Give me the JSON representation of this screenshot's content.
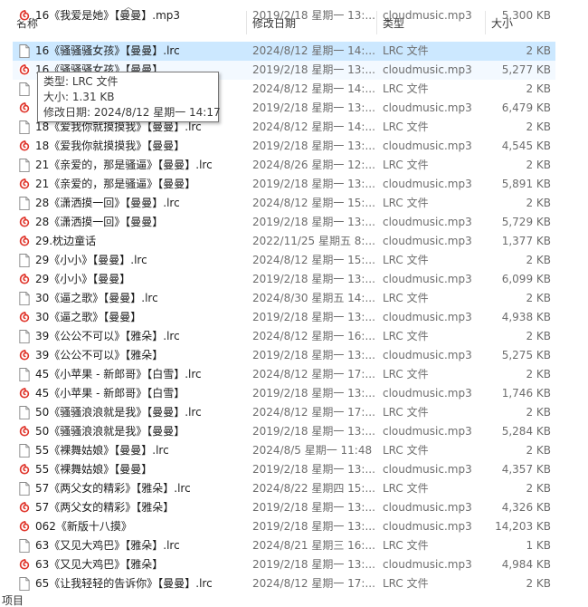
{
  "columns": {
    "name": "名称",
    "date": "修改日期",
    "type": "类型",
    "size": "大小"
  },
  "tooltip": {
    "type_line": "类型: LRC 文件",
    "size_line": "大小: 1.31 KB",
    "date_line": "修改日期: 2024/8/12 星期一 14:17"
  },
  "files": [
    {
      "name": "16《我爱是她》【曼曼】.mp3",
      "date": "2019/2/18 星期一 13:...",
      "type": "cloudmusic.mp3",
      "size": "5,300 KB",
      "kind": "mp3"
    },
    {
      "name": "16《骚骚骚女孩》【曼曼】.lrc",
      "date": "2024/8/12 星期一 14:...",
      "type": "LRC 文件",
      "size": "2 KB",
      "kind": "lrc"
    },
    {
      "name": "16《骚骚骚女孩》【曼曼】",
      "date": "2019/2/18 星期一 13:...",
      "type": "cloudmusic.mp3",
      "size": "5,277 KB",
      "kind": "mp3"
    },
    {
      "name": "",
      "date": "2024/8/12 星期一 14:...",
      "type": "LRC 文件",
      "size": "2 KB",
      "kind": "lrc"
    },
    {
      "name": "",
      "date": "2019/2/18 星期一 13:...",
      "type": "cloudmusic.mp3",
      "size": "6,479 KB",
      "kind": "mp3"
    },
    {
      "name": "18《爱我你就摸摸我》【曼曼】.lrc",
      "date": "2024/8/12 星期一 14:...",
      "type": "LRC 文件",
      "size": "2 KB",
      "kind": "lrc"
    },
    {
      "name": "18《爱我你就摸摸我》【曼曼】",
      "date": "2019/2/18 星期一 13:...",
      "type": "cloudmusic.mp3",
      "size": "4,545 KB",
      "kind": "mp3"
    },
    {
      "name": "21《亲爱的，那是骚逼》【曼曼】.lrc",
      "date": "2024/8/26 星期一 12:...",
      "type": "LRC 文件",
      "size": "2 KB",
      "kind": "lrc"
    },
    {
      "name": "21《亲爱的，那是骚逼》【曼曼】",
      "date": "2019/2/18 星期一 13:...",
      "type": "cloudmusic.mp3",
      "size": "5,891 KB",
      "kind": "mp3"
    },
    {
      "name": "28《潇洒摸一回》【曼曼】.lrc",
      "date": "2024/8/12 星期一 15:...",
      "type": "LRC 文件",
      "size": "2 KB",
      "kind": "lrc"
    },
    {
      "name": "28《潇洒摸一回》【曼曼】",
      "date": "2019/2/18 星期一 13:...",
      "type": "cloudmusic.mp3",
      "size": "5,729 KB",
      "kind": "mp3"
    },
    {
      "name": "29.枕边童话",
      "date": "2022/11/25 星期五 8:...",
      "type": "cloudmusic.mp3",
      "size": "1,377 KB",
      "kind": "mp3"
    },
    {
      "name": "29《小小》【曼曼】.lrc",
      "date": "2024/8/12 星期一 15:...",
      "type": "LRC 文件",
      "size": "2 KB",
      "kind": "lrc"
    },
    {
      "name": "29《小小》【曼曼】",
      "date": "2019/2/18 星期一 13:...",
      "type": "cloudmusic.mp3",
      "size": "6,099 KB",
      "kind": "mp3"
    },
    {
      "name": "30《逼之歌》【曼曼】.lrc",
      "date": "2024/8/30 星期五 14:...",
      "type": "LRC 文件",
      "size": "2 KB",
      "kind": "lrc"
    },
    {
      "name": "30《逼之歌》【曼曼】",
      "date": "2019/2/18 星期一 13:...",
      "type": "cloudmusic.mp3",
      "size": "4,938 KB",
      "kind": "mp3"
    },
    {
      "name": "39《公公不可以》【雅朵】.lrc",
      "date": "2024/8/12 星期一 16:...",
      "type": "LRC 文件",
      "size": "2 KB",
      "kind": "lrc"
    },
    {
      "name": "39《公公不可以》【雅朵】",
      "date": "2019/2/18 星期一 13:...",
      "type": "cloudmusic.mp3",
      "size": "5,275 KB",
      "kind": "mp3"
    },
    {
      "name": "45《小苹果 - 新郎哥》【白雪】.lrc",
      "date": "2024/8/12 星期一 17:...",
      "type": "LRC 文件",
      "size": "2 KB",
      "kind": "lrc"
    },
    {
      "name": "45《小苹果 - 新郎哥》【白雪】",
      "date": "2019/2/18 星期一 13:...",
      "type": "cloudmusic.mp3",
      "size": "1,746 KB",
      "kind": "mp3"
    },
    {
      "name": "50《骚骚浪浪就是我》【曼曼】.lrc",
      "date": "2024/8/12 星期一 17:...",
      "type": "LRC 文件",
      "size": "2 KB",
      "kind": "lrc"
    },
    {
      "name": "50《骚骚浪浪就是我》【曼曼】",
      "date": "2019/2/18 星期一 13:...",
      "type": "cloudmusic.mp3",
      "size": "5,284 KB",
      "kind": "mp3"
    },
    {
      "name": "55《裸舞姑娘》【曼曼】.lrc",
      "date": "2024/8/5 星期一 11:48",
      "type": "LRC 文件",
      "size": "2 KB",
      "kind": "lrc"
    },
    {
      "name": "55《裸舞姑娘》【曼曼】",
      "date": "2019/2/18 星期一 13:...",
      "type": "cloudmusic.mp3",
      "size": "4,357 KB",
      "kind": "mp3"
    },
    {
      "name": "57《两父女的精彩》【雅朵】.lrc",
      "date": "2024/8/22 星期四 15:...",
      "type": "LRC 文件",
      "size": "2 KB",
      "kind": "lrc"
    },
    {
      "name": "57《两父女的精彩》【雅朵】",
      "date": "2019/2/18 星期一 13:...",
      "type": "cloudmusic.mp3",
      "size": "4,326 KB",
      "kind": "mp3"
    },
    {
      "name": "062《新版十八摸》",
      "date": "2019/2/18 星期一 13:...",
      "type": "cloudmusic.mp3",
      "size": "14,203 KB",
      "kind": "mp3"
    },
    {
      "name": "63《又见大鸡巴》【雅朵】.lrc",
      "date": "2024/8/21 星期三 16:...",
      "type": "LRC 文件",
      "size": "1 KB",
      "kind": "lrc"
    },
    {
      "name": "63《又见大鸡巴》【雅朵】",
      "date": "2019/2/18 星期一 13:...",
      "type": "cloudmusic.mp3",
      "size": "4,984 KB",
      "kind": "mp3"
    },
    {
      "name": "65《让我轻轻的告诉你》【曼曼】.lrc",
      "date": "2024/8/12 星期一 17:...",
      "type": "LRC 文件",
      "size": "2 KB",
      "kind": "lrc"
    }
  ],
  "status_bar": {
    "text": "项目"
  },
  "icons": {
    "lrc": "document-icon",
    "mp3": "cloudmusic-icon"
  },
  "colors": {
    "selected_row": "#cce8ff",
    "cloudmusic_red": "#e0362c"
  }
}
